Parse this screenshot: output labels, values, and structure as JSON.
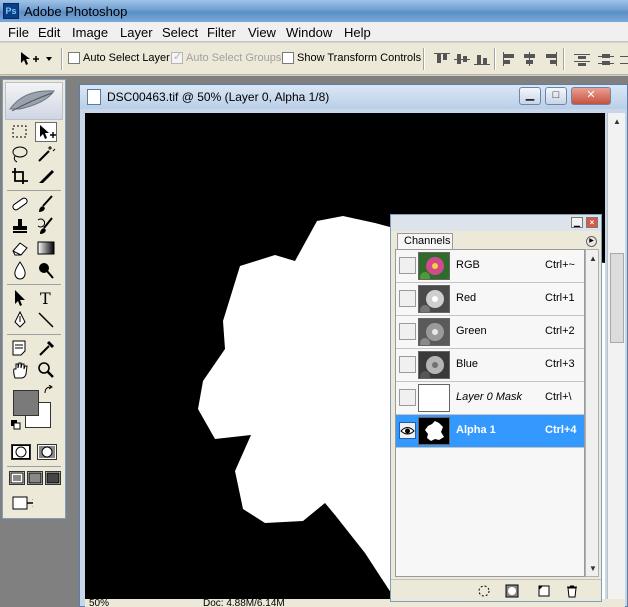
{
  "app": {
    "title": "Adobe Photoshop",
    "icon": "photoshop-app-icon"
  },
  "menu": [
    "File",
    "Edit",
    "Image",
    "Layer",
    "Select",
    "Filter",
    "View",
    "Window",
    "Help"
  ],
  "options": {
    "auto_select_layer": {
      "label": "Auto Select Layer",
      "checked": false,
      "enabled": true
    },
    "auto_select_groups": {
      "label": "Auto Select Groups",
      "checked": true,
      "enabled": false
    },
    "show_transform_controls": {
      "label": "Show Transform Controls",
      "checked": false,
      "enabled": true
    }
  },
  "document": {
    "title": "DSC00463.tif @ 50% (Layer 0, Alpha 1/8)",
    "window_buttons": {
      "minimize": "▁",
      "maximize": "□",
      "close": "✕"
    },
    "status_zoom": "50%",
    "status_doc": "Doc: 4.88M/6.14M"
  },
  "colors": {
    "foreground": "#7a7a7a",
    "background": "#ffffff",
    "selection": "#3399ff",
    "canvas": "#000000"
  },
  "channels": {
    "tab": "Channels",
    "rows": [
      {
        "name": "RGB",
        "shortcut": "Ctrl+~",
        "visible": false,
        "selected": false,
        "thumb": "color-flower-thumbnail"
      },
      {
        "name": "Red",
        "shortcut": "Ctrl+1",
        "visible": false,
        "selected": false,
        "thumb": "grayscale-flower-thumbnail"
      },
      {
        "name": "Green",
        "shortcut": "Ctrl+2",
        "visible": false,
        "selected": false,
        "thumb": "grayscale-flower-thumbnail"
      },
      {
        "name": "Blue",
        "shortcut": "Ctrl+3",
        "visible": false,
        "selected": false,
        "thumb": "grayscale-flower-thumbnail"
      },
      {
        "name": "Layer 0 Mask",
        "shortcut": "Ctrl+\\",
        "visible": false,
        "selected": false,
        "thumb": "white-mask-thumbnail"
      },
      {
        "name": "Alpha 1",
        "shortcut": "Ctrl+4",
        "visible": true,
        "selected": true,
        "thumb": "flower-mask-thumbnail"
      }
    ]
  }
}
